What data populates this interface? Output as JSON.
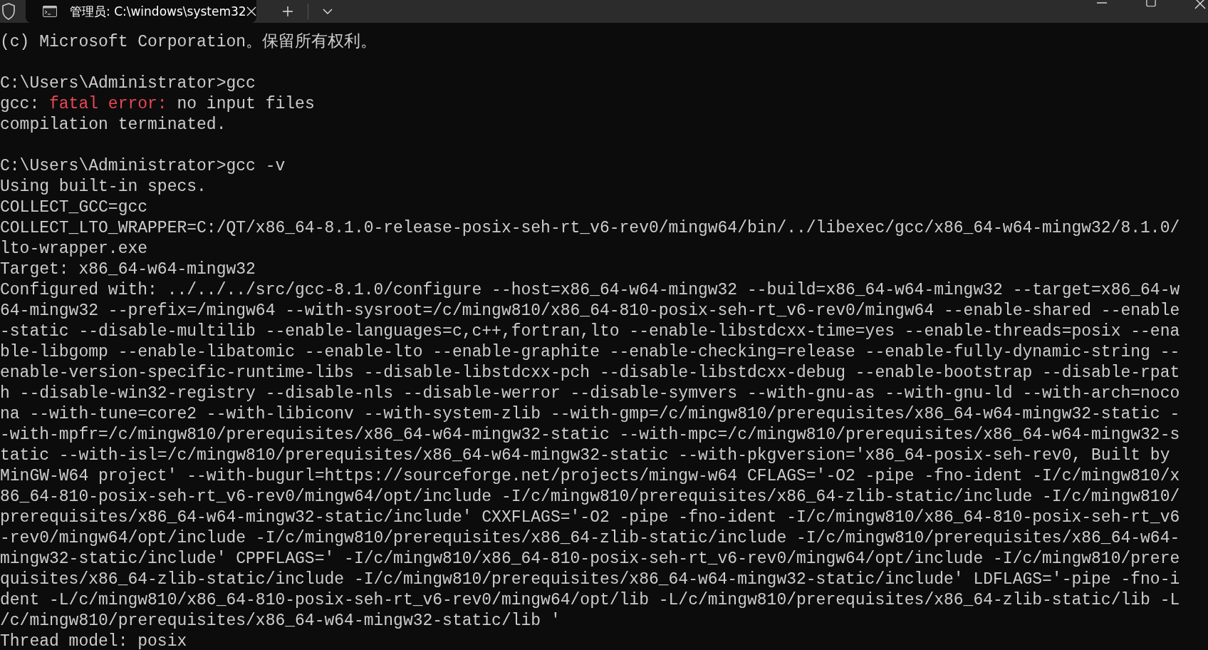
{
  "tabs": [
    {
      "title": "管理员: C:\\windows\\system32",
      "selected": true
    }
  ],
  "lines": [
    {
      "kind": "text",
      "text": "(c) Microsoft Corporation。保留所有权利。"
    },
    {
      "kind": "blank"
    },
    {
      "kind": "text",
      "text": "C:\\Users\\Administrator>gcc"
    },
    {
      "kind": "parts",
      "parts": [
        {
          "kind": "plain",
          "text": "gcc: "
        },
        {
          "kind": "error",
          "text": "fatal error:"
        },
        {
          "kind": "plain",
          "text": " no input files"
        }
      ]
    },
    {
      "kind": "text",
      "text": "compilation terminated."
    },
    {
      "kind": "blank"
    },
    {
      "kind": "text",
      "text": "C:\\Users\\Administrator>gcc -v"
    },
    {
      "kind": "text",
      "text": "Using built-in specs."
    },
    {
      "kind": "text",
      "text": "COLLECT_GCC=gcc"
    },
    {
      "kind": "text",
      "text": "COLLECT_LTO_WRAPPER=C:/QT/x86_64-8.1.0-release-posix-seh-rt_v6-rev0/mingw64/bin/../libexec/gcc/x86_64-w64-mingw32/8.1.0/"
    },
    {
      "kind": "text",
      "text": "lto-wrapper.exe"
    },
    {
      "kind": "text",
      "text": "Target: x86_64-w64-mingw32"
    },
    {
      "kind": "text",
      "text": "Configured with: ../../../src/gcc-8.1.0/configure --host=x86_64-w64-mingw32 --build=x86_64-w64-mingw32 --target=x86_64-w"
    },
    {
      "kind": "text",
      "text": "64-mingw32 --prefix=/mingw64 --with-sysroot=/c/mingw810/x86_64-810-posix-seh-rt_v6-rev0/mingw64 --enable-shared --enable"
    },
    {
      "kind": "text",
      "text": "-static --disable-multilib --enable-languages=c,c++,fortran,lto --enable-libstdcxx-time=yes --enable-threads=posix --ena"
    },
    {
      "kind": "text",
      "text": "ble-libgomp --enable-libatomic --enable-lto --enable-graphite --enable-checking=release --enable-fully-dynamic-string --"
    },
    {
      "kind": "text",
      "text": "enable-version-specific-runtime-libs --disable-libstdcxx-pch --disable-libstdcxx-debug --enable-bootstrap --disable-rpat"
    },
    {
      "kind": "text",
      "text": "h --disable-win32-registry --disable-nls --disable-werror --disable-symvers --with-gnu-as --with-gnu-ld --with-arch=noco"
    },
    {
      "kind": "text",
      "text": "na --with-tune=core2 --with-libiconv --with-system-zlib --with-gmp=/c/mingw810/prerequisites/x86_64-w64-mingw32-static -"
    },
    {
      "kind": "text",
      "text": "-with-mpfr=/c/mingw810/prerequisites/x86_64-w64-mingw32-static --with-mpc=/c/mingw810/prerequisites/x86_64-w64-mingw32-s"
    },
    {
      "kind": "text",
      "text": "tatic --with-isl=/c/mingw810/prerequisites/x86_64-w64-mingw32-static --with-pkgversion='x86_64-posix-seh-rev0, Built by"
    },
    {
      "kind": "text",
      "text": "MinGW-W64 project' --with-bugurl=https://sourceforge.net/projects/mingw-w64 CFLAGS='-O2 -pipe -fno-ident -I/c/mingw810/x"
    },
    {
      "kind": "text",
      "text": "86_64-810-posix-seh-rt_v6-rev0/mingw64/opt/include -I/c/mingw810/prerequisites/x86_64-zlib-static/include -I/c/mingw810/"
    },
    {
      "kind": "text",
      "text": "prerequisites/x86_64-w64-mingw32-static/include' CXXFLAGS='-O2 -pipe -fno-ident -I/c/mingw810/x86_64-810-posix-seh-rt_v6"
    },
    {
      "kind": "text",
      "text": "-rev0/mingw64/opt/include -I/c/mingw810/prerequisites/x86_64-zlib-static/include -I/c/mingw810/prerequisites/x86_64-w64-"
    },
    {
      "kind": "text",
      "text": "mingw32-static/include' CPPFLAGS=' -I/c/mingw810/x86_64-810-posix-seh-rt_v6-rev0/mingw64/opt/include -I/c/mingw810/prere"
    },
    {
      "kind": "text",
      "text": "quisites/x86_64-zlib-static/include -I/c/mingw810/prerequisites/x86_64-w64-mingw32-static/include' LDFLAGS='-pipe -fno-i"
    },
    {
      "kind": "text",
      "text": "dent -L/c/mingw810/x86_64-810-posix-seh-rt_v6-rev0/mingw64/opt/lib -L/c/mingw810/prerequisites/x86_64-zlib-static/lib -L"
    },
    {
      "kind": "text",
      "text": "/c/mingw810/prerequisites/x86_64-w64-mingw32-static/lib '"
    },
    {
      "kind": "text",
      "text": "Thread model: posix"
    }
  ]
}
